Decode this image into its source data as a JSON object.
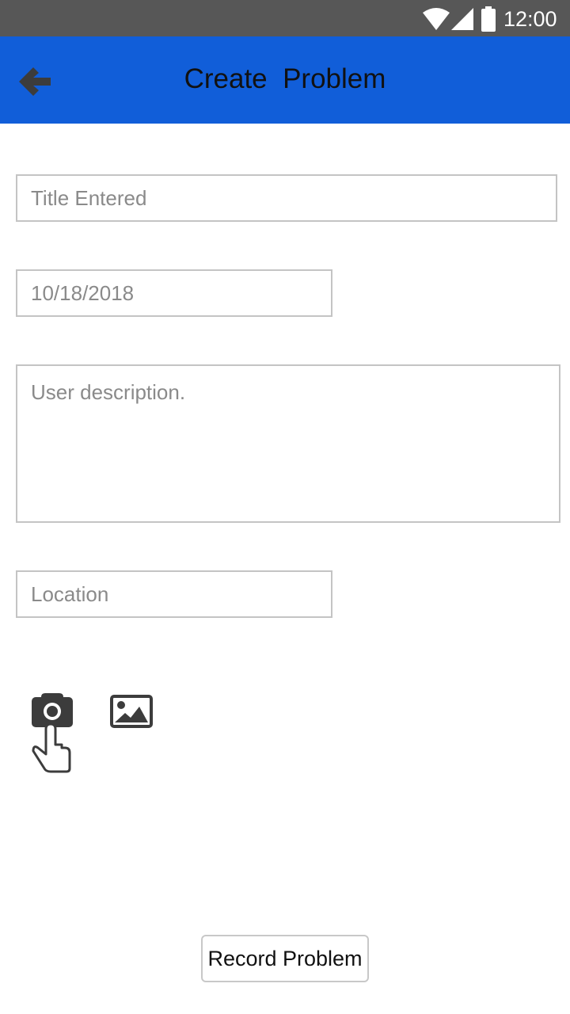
{
  "status_bar": {
    "time": "12:00",
    "icons": [
      "wifi-icon",
      "signal-icon",
      "battery-icon"
    ]
  },
  "app_bar": {
    "title": "Create  Problem",
    "back_icon": "arrow-left-icon",
    "background_color": "#115ed9"
  },
  "form": {
    "title_value": "Title Entered",
    "date_value": "10/18/2018",
    "description_placeholder": "User description.",
    "location_placeholder": "Location"
  },
  "media": {
    "camera_icon": "camera-tap-icon",
    "gallery_icon": "image-gallery-icon"
  },
  "actions": {
    "record_label": "Record Problem"
  }
}
